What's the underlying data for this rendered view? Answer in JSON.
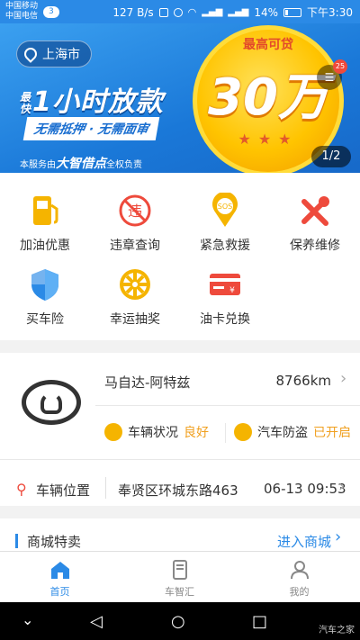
{
  "status_bar": {
    "carrier_1": "中国移动",
    "carrier_2": "中国电信",
    "notification_count": "3",
    "speed": "127 B/s",
    "battery": "14%",
    "time": "下午3:30"
  },
  "banner": {
    "city": "上海市",
    "slogan_prefix": "最快",
    "slogan": "1小时放款",
    "tags": "无需抵押 · 无需面审",
    "service_prefix": "本服务由",
    "service_brand": "大智借点",
    "service_suffix": "全权负责",
    "coin_top": "最高可贷",
    "coin_amount": "30万",
    "message_badge": "25",
    "pager": "1/2"
  },
  "services": [
    {
      "label": "加油优惠",
      "icon": "fuel-pump-icon"
    },
    {
      "label": "违章查询",
      "icon": "violation-icon"
    },
    {
      "label": "紧急救援",
      "icon": "sos-icon"
    },
    {
      "label": "保养维修",
      "icon": "wrench-icon"
    },
    {
      "label": "买车险",
      "icon": "shield-icon"
    },
    {
      "label": "幸运抽奖",
      "icon": "lucky-wheel-icon"
    },
    {
      "label": "油卡兑换",
      "icon": "fuel-card-icon"
    }
  ],
  "car": {
    "name": "马自达-阿特兹",
    "mileage": "8766km",
    "status_label": "车辆状况",
    "status_value": "良好",
    "antitheft_label": "汽车防盗",
    "antitheft_value": "已开启",
    "location_label": "车辆位置",
    "location_address": "奉贤区环城东路463",
    "location_time": "06-13 09:53"
  },
  "mall": {
    "title": "商城特卖",
    "link": "进入商城"
  },
  "tabs": [
    {
      "label": "首页",
      "active": true
    },
    {
      "label": "车智汇",
      "active": false
    },
    {
      "label": "我的",
      "active": false
    }
  ],
  "watermark": "汽车之家",
  "colors": {
    "primary": "#2b8ae6",
    "accent": "#f0a020",
    "red": "#ee4a3c",
    "yellow": "#f5b400"
  }
}
